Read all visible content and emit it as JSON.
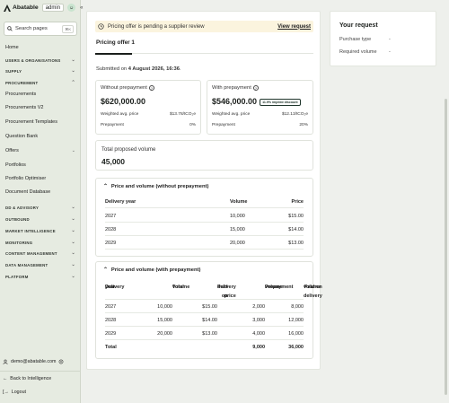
{
  "app": {
    "name": "Abatable",
    "workspace": "admin",
    "collapse_icon": "double-chevron-left-icon"
  },
  "search": {
    "placeholder": "Search pages",
    "shortcut": "⌘K"
  },
  "nav": [
    {
      "label": "Home",
      "type": "item"
    },
    {
      "label": "USERS & ORGANISATIONS",
      "type": "section",
      "chevron": "down"
    },
    {
      "label": "SUPPLY",
      "type": "section",
      "chevron": "down"
    },
    {
      "label": "PROCUREMENT",
      "type": "section",
      "chevron": "up"
    },
    {
      "label": "Procurements",
      "type": "item"
    },
    {
      "label": "Procurements V2",
      "type": "item"
    },
    {
      "label": "Procurement Templates",
      "type": "item"
    },
    {
      "label": "Question Bank",
      "type": "item"
    },
    {
      "label": "Offers",
      "type": "item",
      "chevron": "down"
    },
    {
      "label": "Portfolios",
      "type": "item"
    },
    {
      "label": "Portfolio Optimiser",
      "type": "item"
    },
    {
      "label": "Document Database",
      "type": "item"
    },
    {
      "label": "DD & ADVISORY",
      "type": "section",
      "chevron": "down"
    },
    {
      "label": "OUTBOUND",
      "type": "section",
      "chevron": "down"
    },
    {
      "label": "MARKET INTELLIGENCE",
      "type": "section",
      "chevron": "down"
    },
    {
      "label": "MONITORING",
      "type": "section",
      "chevron": "down"
    },
    {
      "label": "CONTENT MANAGEMENT",
      "type": "section",
      "chevron": "down"
    },
    {
      "label": "DATA MANAGEMENT",
      "type": "section",
      "chevron": "down"
    },
    {
      "label": "PLATFORM",
      "type": "section",
      "chevron": "down"
    }
  ],
  "footer": {
    "email": "demo@abatable.com",
    "back": "Back to Intelligence",
    "logout": "Logout"
  },
  "banner": {
    "text": "Pricing offer is pending a supplier review",
    "link": "View request"
  },
  "tab": "Pricing offer 1",
  "submitted": {
    "prefix": "Submitted on ",
    "date": "4 August 2026, 16:36",
    "suffix": "."
  },
  "without": {
    "title": "Without prepayment",
    "total": "$620,000.00",
    "wap_label": "Weighted avg. price",
    "wap": "$13.78/tCO₂e",
    "pp_label": "Prepayment",
    "pp": "0%"
  },
  "with": {
    "title": "With prepayment",
    "total": "$546,000.00",
    "discount": "11.9% implied discount",
    "wap_label": "Weighted avg. price",
    "wap": "$12.13/tCO₂e",
    "pp_label": "Prepayment",
    "pp": "20%"
  },
  "volume": {
    "label": "Total proposed volume",
    "value": "45,000"
  },
  "table1": {
    "title": "Price and volume (without prepayment)",
    "headers": [
      "Delivery year",
      "Volume",
      "Price"
    ],
    "rows": [
      [
        "2027",
        "10,000",
        "$15.00"
      ],
      [
        "2028",
        "15,000",
        "$14.00"
      ],
      [
        "2029",
        "20,000",
        "$13.00"
      ]
    ]
  },
  "table2": {
    "title": "Price and volume (with prepayment)",
    "headers": [
      [
        "Delivery",
        "year"
      ],
      [
        "Total",
        "volume"
      ],
      [
        "Paid on",
        "delivery price"
      ],
      [
        "Prepayment",
        "volume"
      ],
      [
        "Paid on delivery",
        "volume"
      ]
    ],
    "rows": [
      [
        "2027",
        "10,000",
        "$15.00",
        "2,000",
        "8,000"
      ],
      [
        "2028",
        "15,000",
        "$14.00",
        "3,000",
        "12,000"
      ],
      [
        "2029",
        "20,000",
        "$13.00",
        "4,000",
        "16,000"
      ]
    ],
    "total": [
      "Total",
      "",
      "",
      "9,000",
      "36,000"
    ]
  },
  "request": {
    "title": "Your request",
    "rows": [
      {
        "label": "Purchase type",
        "value": "-"
      },
      {
        "label": "Required volume",
        "value": "-"
      }
    ]
  },
  "colors": {
    "sidebar": "#e6ebe1",
    "banner": "#fbf4de",
    "accent": "#1b1f1c"
  }
}
